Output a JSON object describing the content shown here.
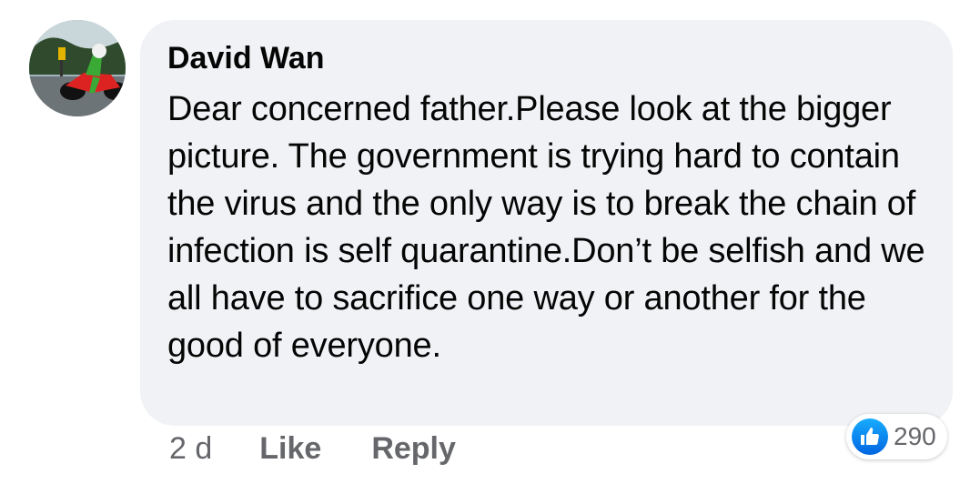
{
  "comment": {
    "author": "David Wan",
    "avatar": "profile-photo-motorcycle",
    "text": "Dear concerned father.Please look at the bigger picture. The government is trying hard to contain the virus and the only way is to break the chain of infection is self quarantine.Don’t be selfish and we all have to sacrifice one way or another for the good of everyone.",
    "timestamp": "2 d",
    "actions": {
      "like_label": "Like",
      "reply_label": "Reply"
    },
    "reactions": {
      "icon": "thumbs-up-icon",
      "count": "290",
      "color": "#1877f2"
    }
  },
  "colors": {
    "bubble_bg": "#f0f2f5",
    "text": "#050505",
    "secondary_text": "#65676b"
  }
}
